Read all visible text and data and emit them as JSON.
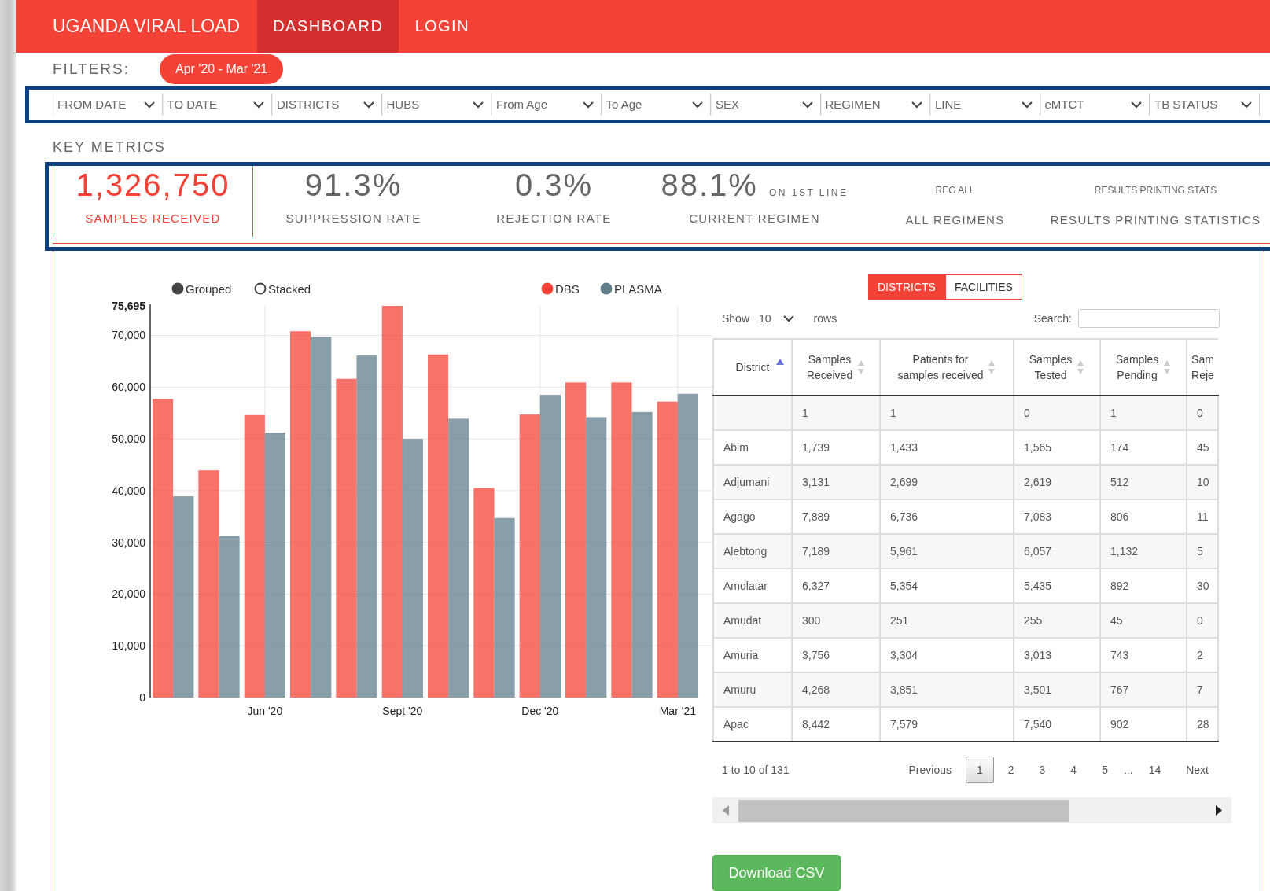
{
  "header": {
    "brand": "UGANDA VIRAL LOAD",
    "nav": [
      {
        "label": "DASHBOARD",
        "selected": true
      },
      {
        "label": "LOGIN",
        "selected": false
      }
    ]
  },
  "filters": {
    "label": "FILTERS:",
    "range": "Apr '20 - Mar '21",
    "dropdowns": [
      "FROM DATE",
      "TO DATE",
      "DISTRICTS",
      "HUBS",
      "From Age",
      "To Age",
      "SEX",
      "REGIMEN",
      "LINE",
      "eMTCT",
      "TB STATUS"
    ]
  },
  "key_metrics": {
    "title": "KEY METRICS",
    "items": [
      {
        "kind": "stat",
        "value": "1,326,750",
        "label": "SAMPLES RECEIVED",
        "selected": true
      },
      {
        "kind": "stat",
        "value": "91.3%",
        "label": "SUPPRESSION RATE",
        "selected": false
      },
      {
        "kind": "stat",
        "value": "0.3%",
        "label": "REJECTION RATE",
        "selected": false
      },
      {
        "kind": "stat",
        "value": "88.1%",
        "note": "ON 1ST LINE",
        "label": "CURRENT REGIMEN",
        "selected": false
      },
      {
        "kind": "caption",
        "caption": "REG ALL",
        "label": "ALL REGIMENS",
        "selected": false
      },
      {
        "kind": "caption",
        "caption": "RESULTS PRINTING STATS",
        "label": "RESULTS PRINTING STATISTICS",
        "selected": false
      }
    ]
  },
  "chart": {
    "modes": [
      {
        "label": "Grouped",
        "selected": true
      },
      {
        "label": "Stacked",
        "selected": false
      }
    ],
    "chart_data": {
      "type": "bar",
      "orientation": "vertical",
      "stacked": false,
      "grid": true,
      "legend": "top-right",
      "ylim": [
        0,
        75695
      ],
      "yticks": [
        {
          "value": 0,
          "label": "0"
        },
        {
          "value": 10000,
          "label": "10,000"
        },
        {
          "value": 20000,
          "label": "20,000"
        },
        {
          "value": 30000,
          "label": "30,000"
        },
        {
          "value": 40000,
          "label": "40,000"
        },
        {
          "value": 50000,
          "label": "50,000"
        },
        {
          "value": 60000,
          "label": "60,000"
        },
        {
          "value": 70000,
          "label": "70,000"
        },
        {
          "value": 75695,
          "label": "75,695"
        }
      ],
      "categories": [
        null,
        null,
        "Jun '20",
        null,
        null,
        "Sept '20",
        null,
        null,
        "Dec '20",
        null,
        null,
        "Mar '21"
      ],
      "series": [
        {
          "name": "DBS",
          "color": "#f44336",
          "values": [
            57700,
            43900,
            54600,
            70800,
            61600,
            75695,
            66300,
            40500,
            54700,
            60900,
            60900,
            57200
          ]
        },
        {
          "name": "PLASMA",
          "color": "#607d8b",
          "values": [
            38900,
            31200,
            51200,
            69700,
            66100,
            50000,
            53900,
            34700,
            58500,
            54200,
            55200,
            58700
          ]
        }
      ]
    }
  },
  "table_panel": {
    "tabs": [
      {
        "label": "DISTRICTS",
        "selected": true
      },
      {
        "label": "FACILITIES",
        "selected": false
      }
    ],
    "length": {
      "show": "Show",
      "value": "10",
      "rows": "rows"
    },
    "search": {
      "label": "Search:"
    },
    "columns": [
      {
        "label": "District",
        "sorted": true
      },
      {
        "label": "Samples\nReceived",
        "sorted": false
      },
      {
        "label": "Patients for\nsamples received",
        "sorted": false
      },
      {
        "label": "Samples\nTested",
        "sorted": false
      },
      {
        "label": "Samples\nPending",
        "sorted": false
      },
      {
        "label": "Sam\nReje"
      }
    ],
    "rows": [
      [
        null,
        "1",
        "1",
        "0",
        "1",
        "0"
      ],
      [
        "Abim",
        "1,739",
        "1,433",
        "1,565",
        "174",
        "45"
      ],
      [
        "Adjumani",
        "3,131",
        "2,699",
        "2,619",
        "512",
        "10"
      ],
      [
        "Agago",
        "7,889",
        "6,736",
        "7,083",
        "806",
        "11"
      ],
      [
        "Alebtong",
        "7,189",
        "5,961",
        "6,057",
        "1,132",
        "5"
      ],
      [
        "Amolatar",
        "6,327",
        "5,354",
        "5,435",
        "892",
        "30"
      ],
      [
        "Amudat",
        "300",
        "251",
        "255",
        "45",
        "0"
      ],
      [
        "Amuria",
        "3,756",
        "3,304",
        "3,013",
        "743",
        "2"
      ],
      [
        "Amuru",
        "4,268",
        "3,851",
        "3,501",
        "767",
        "7"
      ],
      [
        "Apac",
        "8,442",
        "7,579",
        "7,540",
        "902",
        "28"
      ]
    ],
    "info": "1 to 10 of 131",
    "pagination": {
      "previous": "Previous",
      "next": "Next",
      "pages": [
        {
          "kind": "page",
          "label": "1",
          "selected": true
        },
        {
          "kind": "page",
          "label": "2",
          "selected": false
        },
        {
          "kind": "page",
          "label": "3",
          "selected": false
        },
        {
          "kind": "page",
          "label": "4",
          "selected": false
        },
        {
          "kind": "page",
          "label": "5",
          "selected": false
        },
        {
          "kind": "ellipsis",
          "label": "..."
        },
        {
          "kind": "page",
          "label": "14",
          "selected": false
        }
      ]
    },
    "download": "Download CSV"
  }
}
